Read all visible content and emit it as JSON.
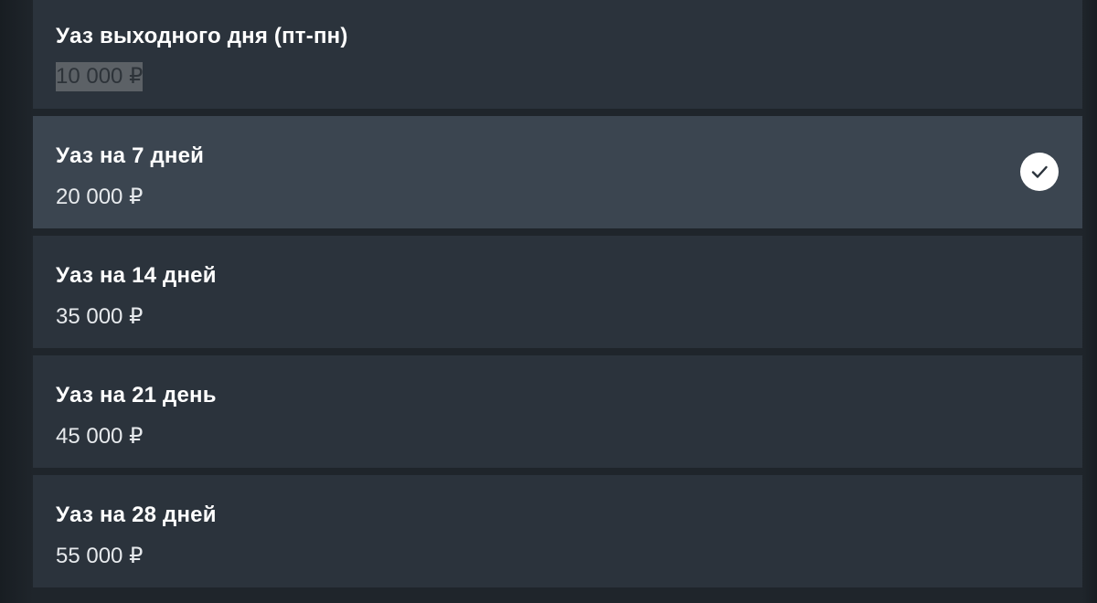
{
  "options": [
    {
      "title": "Уаз выходного дня (пт-пн)",
      "price": "10 000 ₽",
      "selected": false
    },
    {
      "title": "Уаз на 7 дней",
      "price": "20 000 ₽",
      "selected": true
    },
    {
      "title": "Уаз на 14 дней",
      "price": "35 000 ₽",
      "selected": false
    },
    {
      "title": "Уаз на 21 день",
      "price": "45 000 ₽",
      "selected": false
    },
    {
      "title": "Уаз на 28 дней",
      "price": "55 000 ₽",
      "selected": false
    }
  ],
  "colors": {
    "card": "#2b333c",
    "card_selected": "#3b4550",
    "text": "#ffffff",
    "check_badge": "#ffffff",
    "check_mark": "#2b333c"
  },
  "icons": {
    "selected_indicator": "checkmark-circle-icon"
  }
}
